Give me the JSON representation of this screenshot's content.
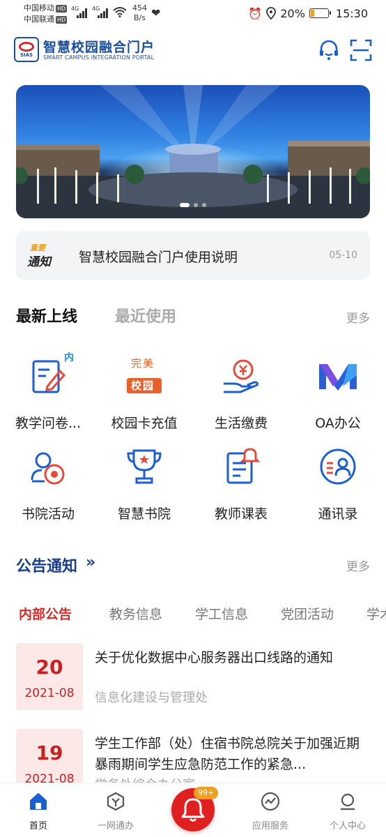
{
  "status_bar": {
    "carrier1": "中国移动",
    "carrier2": "中国联通",
    "hd": "HD",
    "net": "4G",
    "speed_value": "454",
    "speed_unit": "B/s",
    "battery": "20%",
    "battery_level": 0.2,
    "time": "15:30"
  },
  "header": {
    "logo_text": "SIAS",
    "title": "智慧校园融合门户",
    "subtitle": "SMART CAMPUS INTEGRATION PORTAL"
  },
  "banner": {
    "dots_total": 3,
    "active_dot": 0
  },
  "notice": {
    "tag_line1": "重要",
    "tag_line2": "通知",
    "text": "智慧校园融合门户使用说明",
    "date": "05-10"
  },
  "apps_section": {
    "tab_active": "最新上线",
    "tab_other": "最近使用",
    "more": "更多",
    "items": [
      {
        "label": "教学问卷...",
        "icon": "questionnaire-icon"
      },
      {
        "label": "校园卡充值",
        "icon": "campus-card-icon"
      },
      {
        "label": "生活缴费",
        "icon": "payment-icon"
      },
      {
        "label": "OA办公",
        "icon": "oa-office-icon"
      },
      {
        "label": "书院活动",
        "icon": "academy-activity-icon"
      },
      {
        "label": "智慧书院",
        "icon": "trophy-icon"
      },
      {
        "label": "教师课表",
        "icon": "schedule-icon"
      },
      {
        "label": "通讯录",
        "icon": "contacts-icon"
      }
    ],
    "badge_inner": "内",
    "card_text_top": "完美",
    "card_text_bottom": "校园"
  },
  "announcements": {
    "title": "公告通知",
    "more": "更多",
    "categories": [
      "内部公告",
      "教务信息",
      "学工信息",
      "党团活动",
      "学术"
    ],
    "items": [
      {
        "day": "20",
        "year_month": "2021-08",
        "title": "关于优化数据中心服务器出口线路的通知",
        "source": "信息化建设与管理处"
      },
      {
        "day": "19",
        "year_month": "2021-08",
        "title": "学生工作部（处）住宿书院总院关于加强近期暴雨期间学生应急防范工作的紧急...",
        "source": "党务处综合办公室"
      }
    ]
  },
  "bottom_nav": {
    "items": [
      "首页",
      "一网通办",
      "应用服务",
      "个人中心"
    ],
    "badge": "99+"
  },
  "colors": {
    "brand_blue": "#1a4fa0",
    "accent_red": "#d42a2a",
    "date_bg": "#fde8e8"
  }
}
